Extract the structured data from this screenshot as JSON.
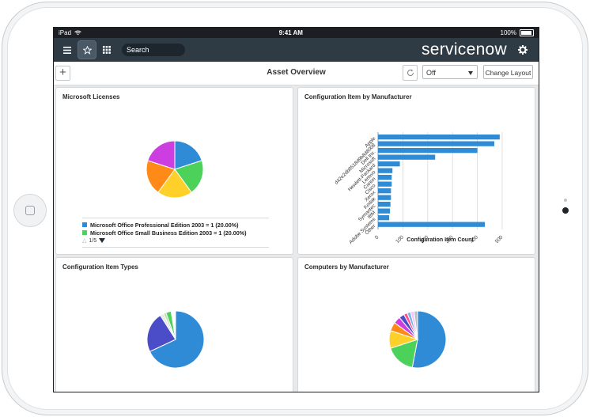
{
  "status_bar": {
    "device": "iPad",
    "time": "9:41 AM",
    "battery": "100%"
  },
  "nav": {
    "search_placeholder": "Search",
    "brand": "servicenow"
  },
  "toolbar": {
    "title": "Asset Overview",
    "select_value": "Off",
    "change_layout_label": "Change Layout"
  },
  "panels": {
    "microsoft_licenses": {
      "title": "Microsoft Licenses",
      "legend": [
        {
          "label": "Microsoft Office Professional Edition 2003 = 1 (20.00%)",
          "color": "#2f8bd6"
        },
        {
          "label": "Microsoft Office Small Business Edition 2003 = 1 (20.00%)",
          "color": "#4cd25b"
        }
      ],
      "pager": "1/5",
      "chart_data": {
        "type": "pie",
        "slices": [
          {
            "label": "Microsoft Office Professional Edition 2003",
            "value": 1,
            "color": "#2f8bd6"
          },
          {
            "label": "Microsoft Office Small Business Edition 2003",
            "value": 1,
            "color": "#4cd25b"
          },
          {
            "value": 1,
            "color": "#ffd02a"
          },
          {
            "value": 1,
            "color": "#ff8a17"
          },
          {
            "value": 1,
            "color": "#cc3ee0"
          }
        ]
      }
    },
    "ci_by_manufacturer": {
      "title": "Configuration Item by Manufacturer",
      "chart_data": {
        "type": "bar",
        "orientation": "horizontal",
        "categories": [
          "Apple",
          "d42e2db8518d9b8d8008",
          "Dell Inc.",
          "Microsoft",
          "Hewlett-Packard",
          "Lenovo",
          "Canon",
          "Cisco",
          "Xerox",
          "Kodak",
          "Symantec",
          "IBM",
          "Adobe Systems",
          "Other"
        ],
        "values": [
          490,
          468,
          400,
          230,
          88,
          58,
          55,
          55,
          52,
          52,
          50,
          48,
          45,
          430
        ],
        "xlabel": "Configuration Item Count",
        "xticks": [
          0,
          100,
          200,
          300,
          400,
          500
        ],
        "xlim": [
          0,
          500
        ],
        "color": "#2f8bd6"
      }
    },
    "ci_types": {
      "title": "Configuration Item Types",
      "chart_data": {
        "type": "pie",
        "slices": [
          {
            "value": 68,
            "color": "#2f8bd6"
          },
          {
            "value": 23,
            "color": "#4a4cc8"
          },
          {
            "value": 2,
            "color": "#e8e8e8"
          },
          {
            "value": 1.5,
            "color": "#b9e0a8"
          },
          {
            "value": 3,
            "color": "#4cd25b"
          },
          {
            "value": 2.5,
            "color": "#ffffff"
          }
        ]
      }
    },
    "computers_by_manufacturer": {
      "title": "Computers by Manufacturer",
      "chart_data": {
        "type": "pie",
        "slices": [
          {
            "value": 53,
            "color": "#2f8bd6"
          },
          {
            "value": 17,
            "color": "#4cd25b"
          },
          {
            "value": 10,
            "color": "#ffd02a"
          },
          {
            "value": 5,
            "color": "#ff8a17"
          },
          {
            "value": 4,
            "color": "#cc3ee0"
          },
          {
            "value": 3,
            "color": "#4a4cc8"
          },
          {
            "value": 2,
            "color": "#ff4d8d"
          },
          {
            "value": 2,
            "color": "#7fb3e6"
          },
          {
            "value": 2,
            "color": "#e9c9ff"
          },
          {
            "value": 2,
            "color": "#bdbdbd"
          }
        ]
      }
    }
  }
}
